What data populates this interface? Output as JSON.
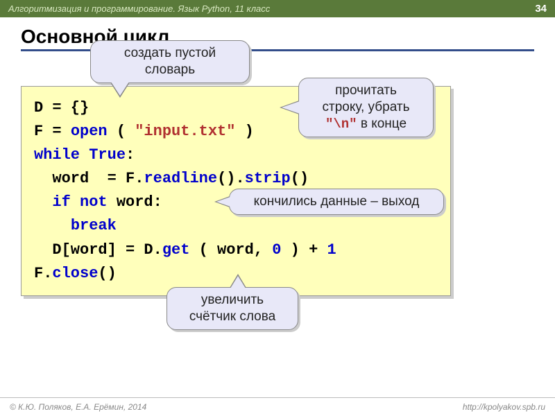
{
  "header": {
    "subject": "Алгоритмизация и программирование. Язык Python, 11 класс",
    "page": "34"
  },
  "title": "Основной цикл",
  "callouts": {
    "c1": "создать пустой словарь",
    "c2_line1": "прочитать",
    "c2_line2": "строку, убрать",
    "c2_red": "\"\\n\"",
    "c2_tail": "  в конце",
    "c3": "кончились данные – выход",
    "c4_line1": "увеличить",
    "c4_line2": "счётчик слова"
  },
  "code": {
    "l1a": "D = {}",
    "l2a": "F = ",
    "l2b": "open",
    "l2c": " ( ",
    "l2d": "\"input.txt\"",
    "l2e": " )",
    "l3a": "while",
    "l3b": " ",
    "l3c": "True",
    "l3d": ":",
    "l4a": "  word  = F.",
    "l4b": "readline",
    "l4c": "().",
    "l4d": "strip",
    "l4e": "()",
    "l5a": "  ",
    "l5b": "if",
    "l5c": " ",
    "l5d": "not",
    "l5e": " word:",
    "l6a": "    ",
    "l6b": "break",
    "l7a": "  D[word] = D.",
    "l7b": "get",
    "l7c": " ( word, ",
    "l7d": "0",
    "l7e": " ) + ",
    "l7f": "1",
    "l8a": "F.",
    "l8b": "close",
    "l8c": "()"
  },
  "footer": {
    "left": "© К.Ю. Поляков, Е.А. Ерёмин, 2014",
    "right": "http://kpolyakov.spb.ru"
  }
}
